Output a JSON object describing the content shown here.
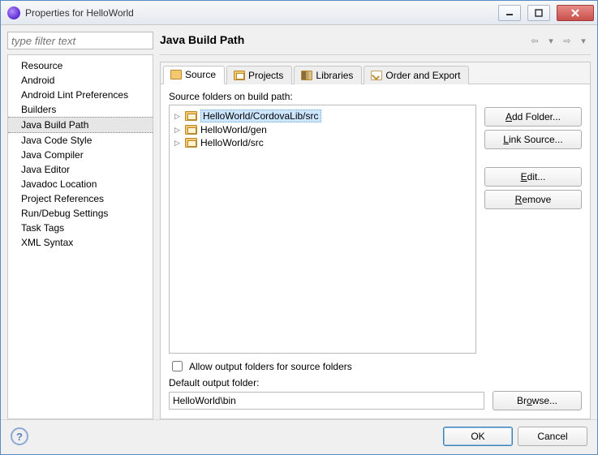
{
  "window": {
    "title": "Properties for HelloWorld"
  },
  "filter": {
    "placeholder": "type filter text"
  },
  "nav": {
    "items": [
      "Resource",
      "Android",
      "Android Lint Preferences",
      "Builders",
      "Java Build Path",
      "Java Code Style",
      "Java Compiler",
      "Java Editor",
      "Javadoc Location",
      "Project References",
      "Run/Debug Settings",
      "Task Tags",
      "XML Syntax"
    ],
    "selectedIndex": 4
  },
  "page": {
    "title": "Java Build Path",
    "tabs": [
      {
        "label": "Source"
      },
      {
        "label": "Projects"
      },
      {
        "label": "Libraries"
      },
      {
        "label": "Order and Export"
      }
    ],
    "activeTab": 0,
    "sourceSection": {
      "label": "Source folders on build path:",
      "folders": [
        "HelloWorld/CordovaLib/src",
        "HelloWorld/gen",
        "HelloWorld/src"
      ],
      "selectedIndex": 0,
      "buttons": {
        "addFolder": "Add Folder...",
        "linkSource": "Link Source...",
        "edit": "Edit...",
        "remove": "Remove"
      },
      "allowOutput": {
        "label": "Allow output folders for source folders",
        "checked": false
      },
      "defaultOutputLabel": "Default output folder:",
      "defaultOutputValue": "HelloWorld\\bin",
      "browse": "Browse..."
    }
  },
  "footer": {
    "ok": "OK",
    "cancel": "Cancel"
  }
}
